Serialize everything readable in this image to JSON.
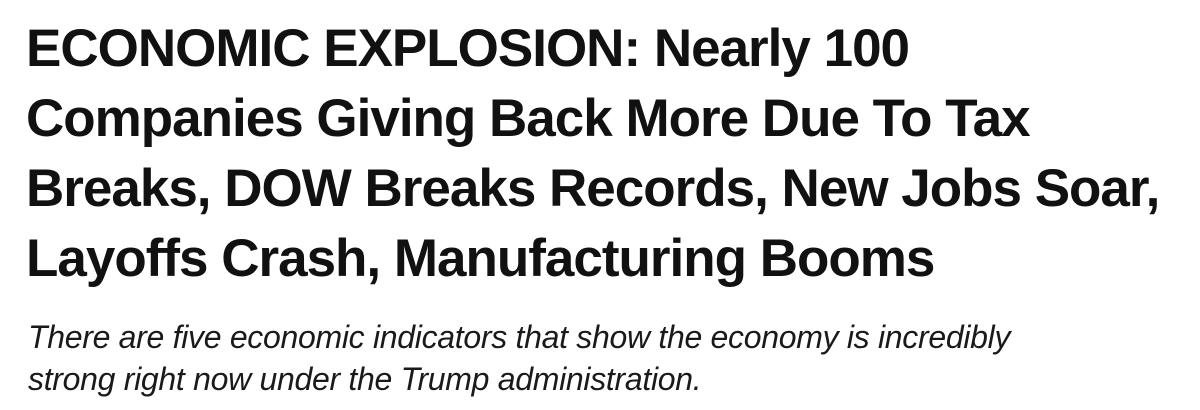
{
  "article": {
    "headline_lines": [
      "ECONOMIC EXPLOSION: Nearly 100",
      "Companies Giving Back More Due To Tax",
      "Breaks, DOW Breaks Records, New Jobs Soar,",
      "Layoffs Crash, Manufacturing Booms"
    ],
    "subheadline_lines": [
      "There are five economic indicators that show the economy is incredibly",
      "strong right now under the Trump administration."
    ]
  }
}
